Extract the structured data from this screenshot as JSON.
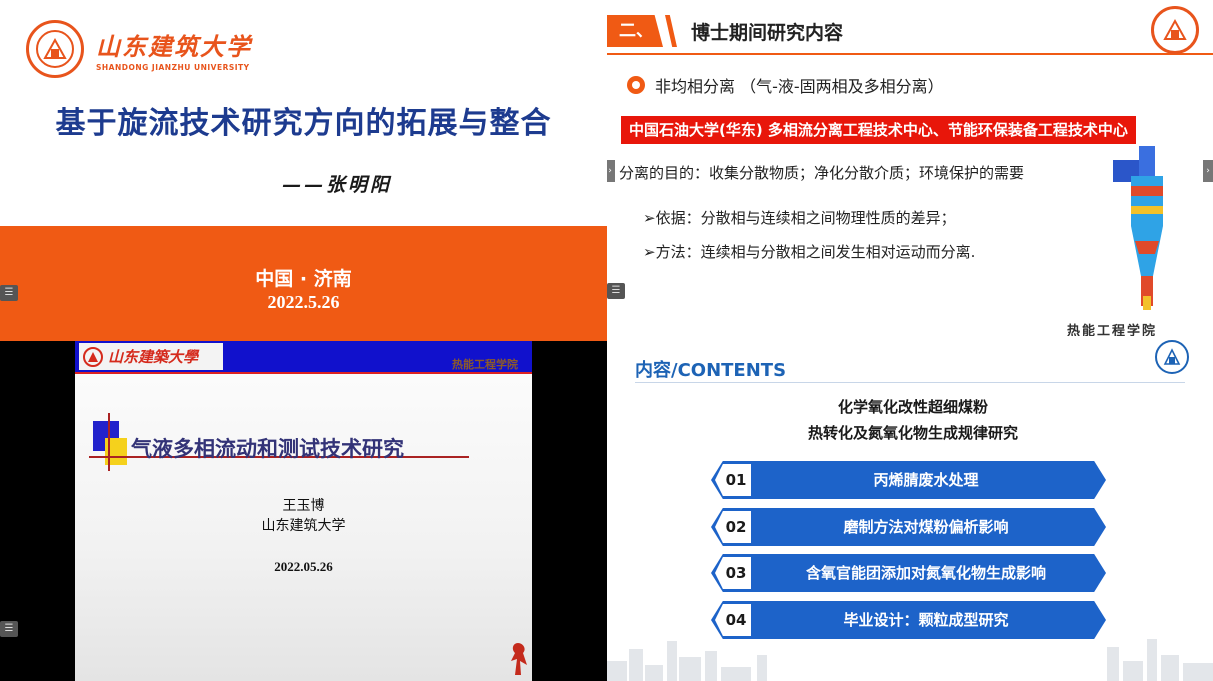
{
  "slide1": {
    "logo_cn": "山东建筑大学",
    "logo_en": "SHANDONG JIANZHU UNIVERSITY",
    "title": "基于旋流技术研究方向的拓展与整合",
    "author": "——张明阳",
    "location": "中国 · 济南",
    "date": "2022.5.26",
    "accent": "#f05a14"
  },
  "slide2": {
    "section_number": "二、",
    "section_title": "博士期间研究内容",
    "subtitle": "非均相分离 （气-液-固两相及多相分离）",
    "banner": "中国石油大学(华东) 多相流分离工程技术中心、节能环保装备工程技术中心",
    "purpose": "分离的目的：收集分散物质；净化分散介质；环境保护的需要",
    "basis": "➢依据：分散相与连续相之间物理性质的差异；",
    "method": "➢方法：连续相与分散相之间发生相对运动而分离.",
    "footer": "热能工程学院"
  },
  "slide3": {
    "logo_cn": "山东建築大學",
    "dept": "热能工程学院",
    "title": "气液多相流动和测试技术研究",
    "presenter": "王玉博",
    "university": "山东建筑大学",
    "date": "2022.05.26"
  },
  "slide4": {
    "heading": "内容/CONTENTS",
    "subtitle_line1": "化学氧化改性超细煤粉",
    "subtitle_line2": "热转化及氮氧化物生成规律研究",
    "items": [
      {
        "num": "01",
        "label": "丙烯腈废水处理"
      },
      {
        "num": "02",
        "label": "磨制方法对煤粉偏析影响"
      },
      {
        "num": "03",
        "label": "含氧官能团添加对氮氧化物生成影响"
      },
      {
        "num": "04",
        "label": "毕业设计：颗粒成型研究"
      }
    ],
    "accent": "#1d63c9"
  }
}
